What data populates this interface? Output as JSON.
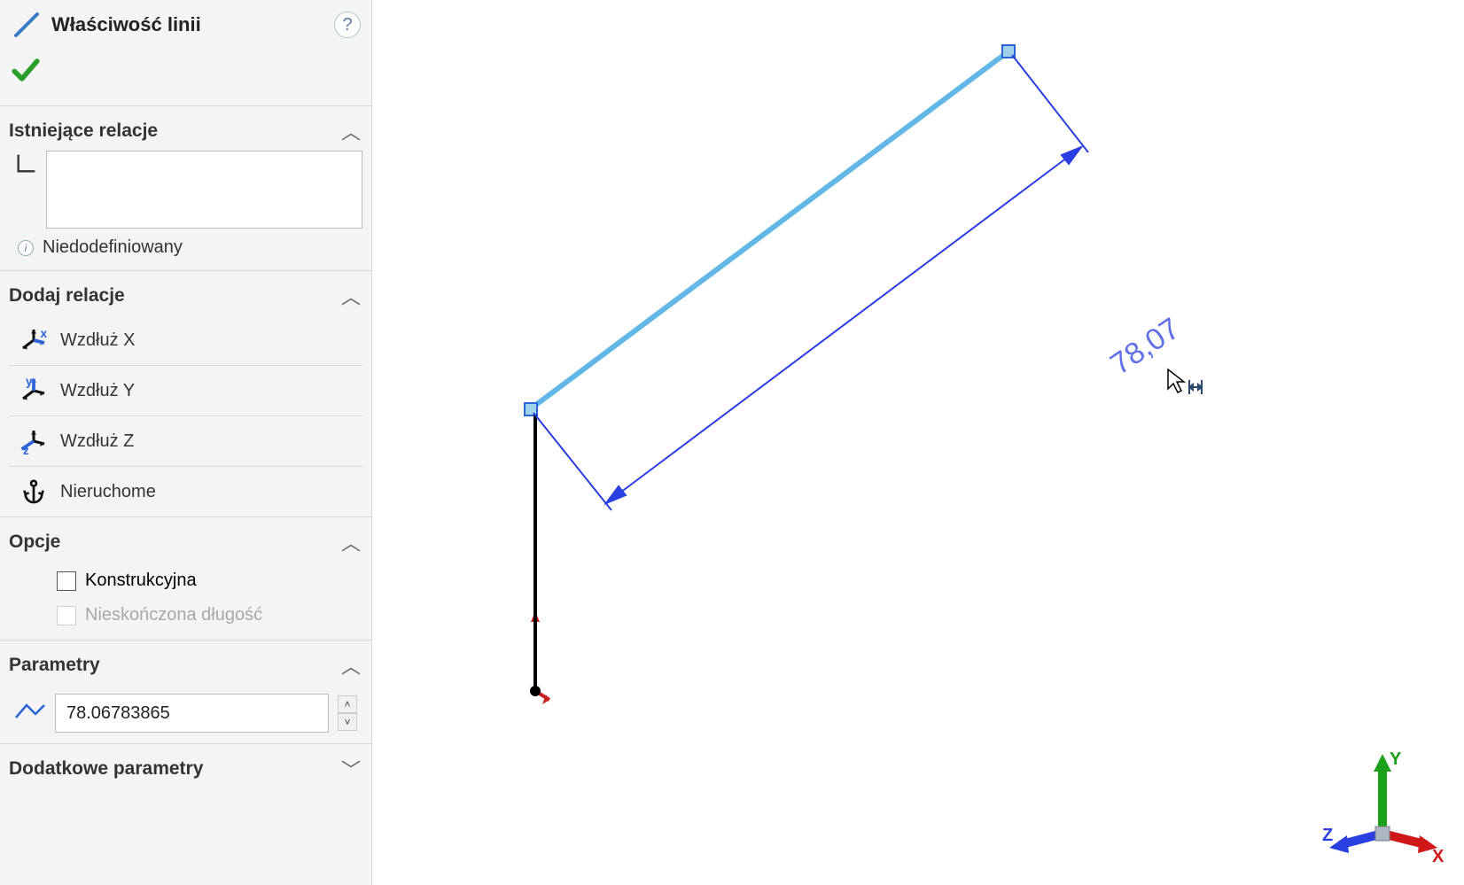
{
  "panel": {
    "title": "Właściwość linii",
    "sections": {
      "existing_relations": {
        "title": "Istniejące relacje"
      },
      "add_relations": {
        "title": "Dodaj relacje",
        "along_x": "Wzdłuż X",
        "along_y": "Wzdłuż Y",
        "along_z": "Wzdłuż Z",
        "fixed": "Nieruchome"
      },
      "status": {
        "text": "Niedodefiniowany"
      },
      "options": {
        "title": "Opcje",
        "construction": "Konstrukcyjna",
        "infinite_length": "Nieskończona długość"
      },
      "parameters": {
        "title": "Parametry",
        "length_value": "78.06783865"
      },
      "additional_parameters": {
        "title": "Dodatkowe parametry"
      }
    }
  },
  "viewport": {
    "dimension_label": "78,07",
    "triad": {
      "x": "X",
      "y": "Y",
      "z": "Z"
    }
  }
}
